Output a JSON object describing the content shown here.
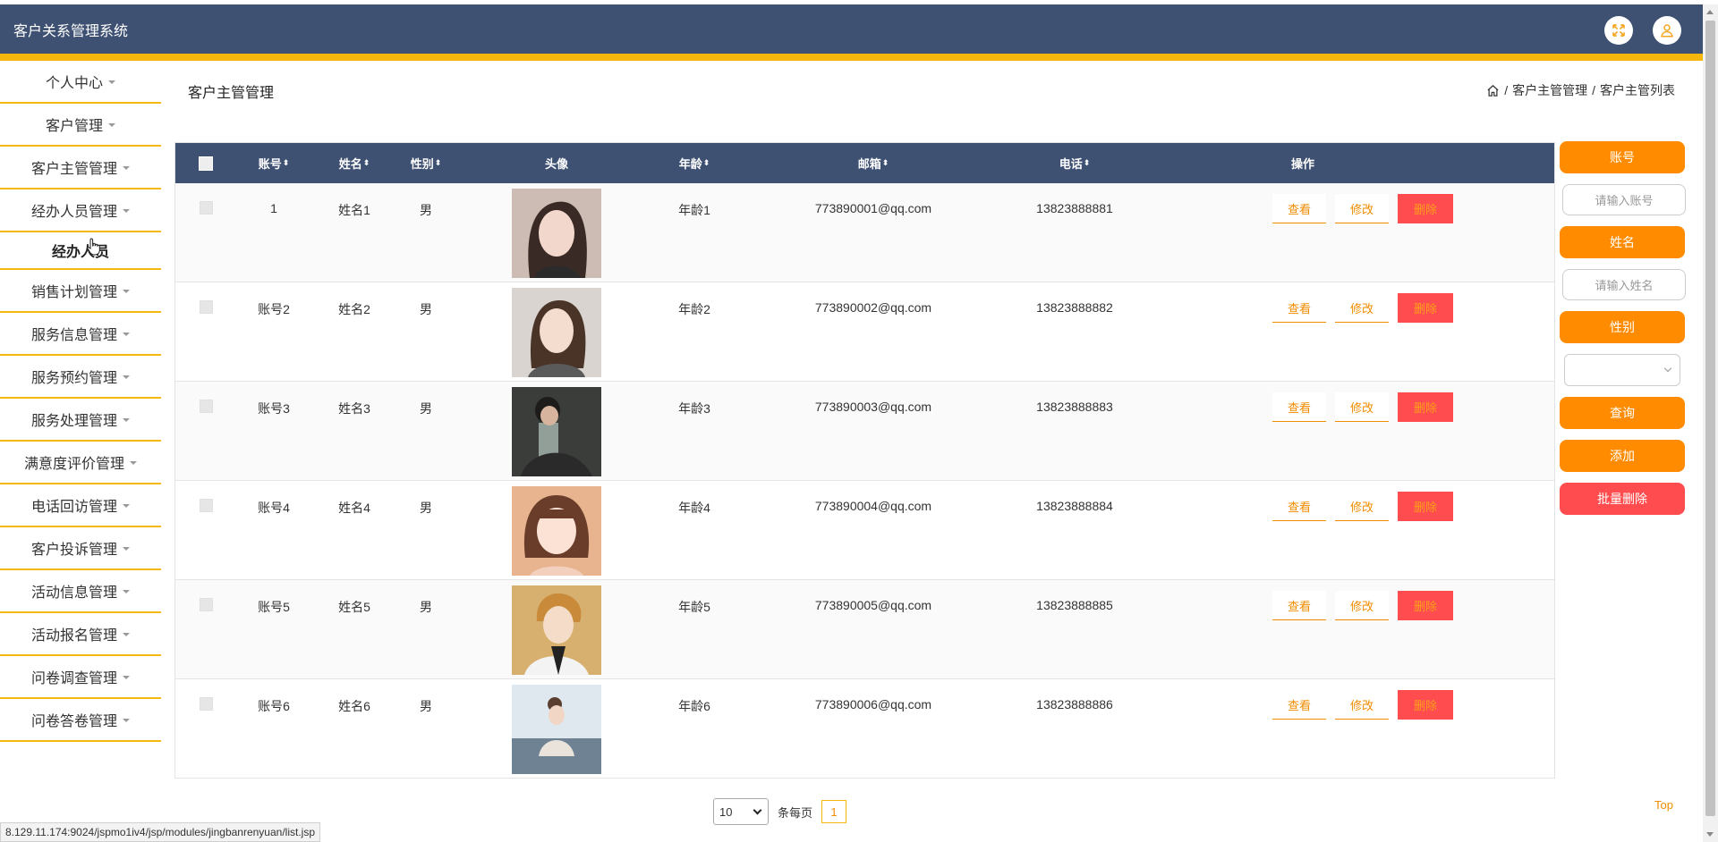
{
  "app": {
    "title": "客户关系管理系统"
  },
  "sidebar": {
    "items": [
      {
        "label": "个人中心"
      },
      {
        "label": "客户管理"
      },
      {
        "label": "客户主管管理"
      },
      {
        "label": "经办人员管理"
      },
      {
        "label": "经办人员",
        "sub": true
      },
      {
        "label": "销售计划管理"
      },
      {
        "label": "服务信息管理"
      },
      {
        "label": "服务预约管理"
      },
      {
        "label": "服务处理管理"
      },
      {
        "label": "满意度评价管理"
      },
      {
        "label": "电话回访管理"
      },
      {
        "label": "客户投诉管理"
      },
      {
        "label": "活动信息管理"
      },
      {
        "label": "活动报名管理"
      },
      {
        "label": "问卷调查管理"
      },
      {
        "label": "问卷答卷管理"
      }
    ]
  },
  "page": {
    "title": "客户主管管理",
    "breadcrumb": [
      "客户主管管理",
      "客户主管列表"
    ],
    "breadcrumb_sep": "/"
  },
  "table": {
    "headers": {
      "account": "账号",
      "name": "姓名",
      "gender": "性别",
      "avatar": "头像",
      "age": "年龄",
      "email": "邮箱",
      "phone": "电话",
      "actions": "操作"
    },
    "sort_glyph": "⬍",
    "rows": [
      {
        "account": "1",
        "name": "姓名1",
        "gender": "男",
        "age": "年龄1",
        "email": "773890001@qq.com",
        "phone": "13823888881"
      },
      {
        "account": "账号2",
        "name": "姓名2",
        "gender": "男",
        "age": "年龄2",
        "email": "773890002@qq.com",
        "phone": "13823888882"
      },
      {
        "account": "账号3",
        "name": "姓名3",
        "gender": "男",
        "age": "年龄3",
        "email": "773890003@qq.com",
        "phone": "13823888883"
      },
      {
        "account": "账号4",
        "name": "姓名4",
        "gender": "男",
        "age": "年龄4",
        "email": "773890004@qq.com",
        "phone": "13823888884"
      },
      {
        "account": "账号5",
        "name": "姓名5",
        "gender": "男",
        "age": "年龄5",
        "email": "773890005@qq.com",
        "phone": "13823888885"
      },
      {
        "account": "账号6",
        "name": "姓名6",
        "gender": "男",
        "age": "年龄6",
        "email": "773890006@qq.com",
        "phone": "13823888886"
      }
    ],
    "actions": {
      "view": "查看",
      "edit": "修改",
      "delete": "删除"
    }
  },
  "panel": {
    "account_label": "账号",
    "account_placeholder": "请输入账号",
    "name_label": "姓名",
    "name_placeholder": "请输入姓名",
    "gender_label": "性别",
    "search_label": "查询",
    "add_label": "添加",
    "batch_delete_label": "批量删除"
  },
  "pagination": {
    "page_size": "10",
    "per_page_label": "条每页",
    "current_page": "1"
  },
  "top_link": "Top",
  "status_url": "8.129.11.174:9024/jspmo1iv4/jsp/modules/jingbanrenyuan/list.jsp",
  "colors": {
    "header": "#3f5173",
    "accent": "#f5b60d",
    "primary": "#ff8c00",
    "danger": "#ff4d4f"
  }
}
